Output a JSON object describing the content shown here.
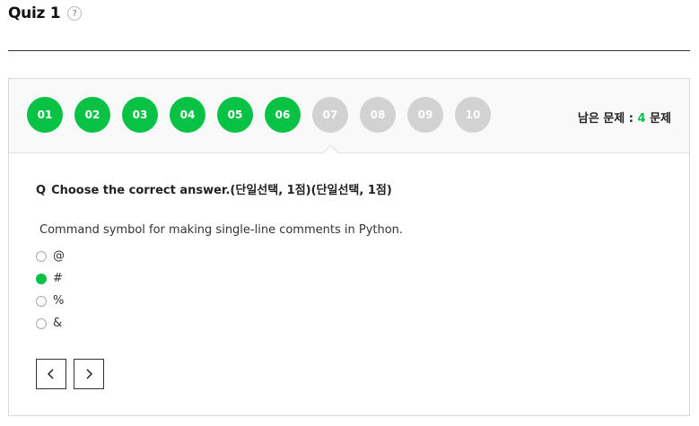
{
  "header": {
    "title": "Quiz 1",
    "help_icon": "?"
  },
  "nav": {
    "questions": [
      {
        "label": "01",
        "status": "answered"
      },
      {
        "label": "02",
        "status": "answered"
      },
      {
        "label": "03",
        "status": "answered"
      },
      {
        "label": "04",
        "status": "answered"
      },
      {
        "label": "05",
        "status": "answered"
      },
      {
        "label": "06",
        "status": "answered"
      },
      {
        "label": "07",
        "status": "unanswered"
      },
      {
        "label": "08",
        "status": "unanswered"
      },
      {
        "label": "09",
        "status": "unanswered"
      },
      {
        "label": "10",
        "status": "unanswered"
      }
    ],
    "remaining_prefix": "남은 문제 :",
    "remaining_count": "4",
    "remaining_suffix": "문제"
  },
  "question": {
    "marker": "Q",
    "text": "Choose the correct answer.(단일선택, 1점)(단일선택, 1점)",
    "prompt": "Command symbol for making single-line comments in Python.",
    "options": [
      {
        "label": "@",
        "selected": false
      },
      {
        "label": "#",
        "selected": true
      },
      {
        "label": "%",
        "selected": false
      },
      {
        "label": "&",
        "selected": false
      }
    ]
  },
  "pager": {
    "prev_icon": "chevron-left-icon",
    "next_icon": "chevron-right-icon"
  },
  "colors": {
    "accent": "#08c246",
    "inactive": "#d2d2d2"
  }
}
